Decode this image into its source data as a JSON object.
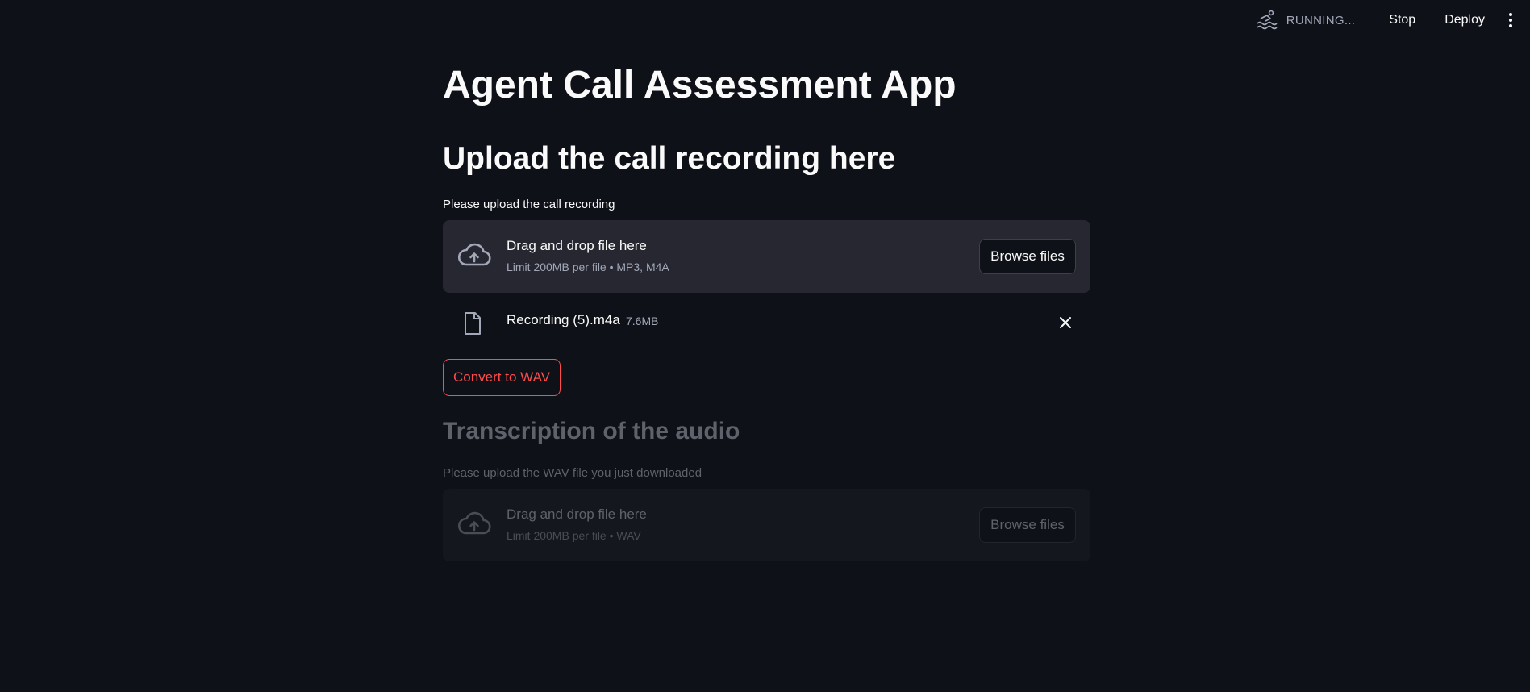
{
  "topbar": {
    "status_icon": "running-swimmer-icon",
    "status_text": "RUNNING...",
    "stop_label": "Stop",
    "deploy_label": "Deploy",
    "menu_icon": "kebab-menu-icon"
  },
  "main": {
    "title": "Agent Call Assessment App",
    "upload_section": {
      "heading": "Upload the call recording here",
      "label": "Please upload the call recording",
      "dropzone": {
        "icon": "cloud-upload-icon",
        "title": "Drag and drop file here",
        "subtitle": "Limit 200MB per file • MP3, M4A",
        "browse_label": "Browse files"
      },
      "uploaded_file": {
        "icon": "file-icon",
        "name": "Recording (5).m4a",
        "size": "7.6MB",
        "remove_icon": "close-icon"
      },
      "convert_label": "Convert to WAV"
    },
    "transcription_section": {
      "heading": "Transcription of the audio",
      "label": "Please upload the WAV file you just downloaded",
      "dropzone": {
        "icon": "cloud-upload-icon",
        "title": "Drag and drop file here",
        "subtitle": "Limit 200MB per file • WAV",
        "browse_label": "Browse files"
      }
    }
  },
  "colors": {
    "background": "#0e1117",
    "dropzone": "#262730",
    "accent": "#ff4b4b",
    "text": "#fafafa",
    "muted": "#a3a8b8"
  }
}
